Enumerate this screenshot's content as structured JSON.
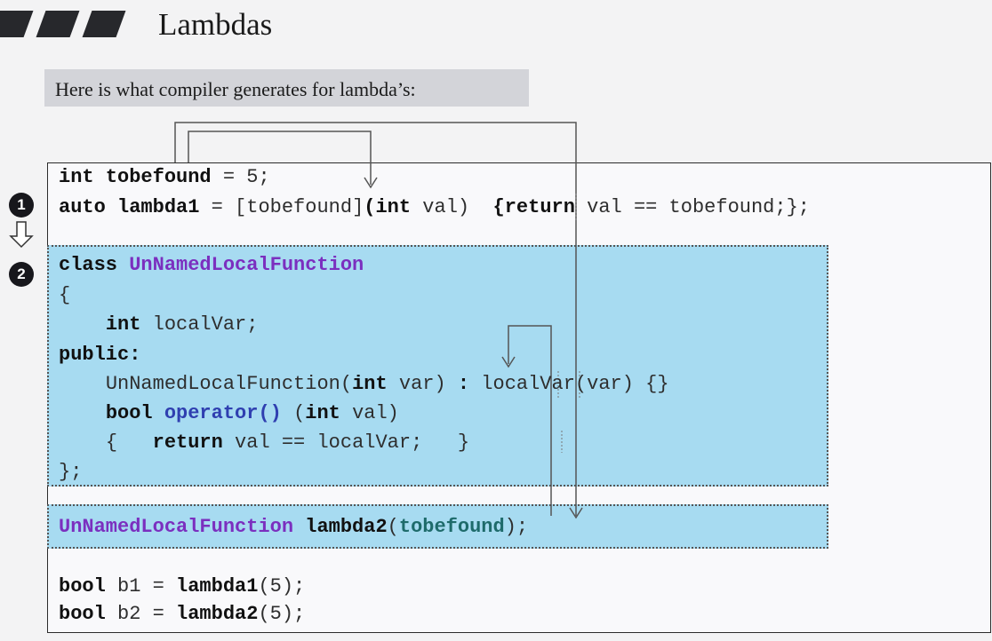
{
  "slide": {
    "title": "Lambdas",
    "subtitle": "Here is what compiler generates for lambda’s:",
    "badge1": "1",
    "badge2": "2"
  },
  "code": {
    "l1": {
      "kw": "int",
      "name": "tobefound",
      "rest": " = 5;"
    },
    "l2": {
      "kw": "auto",
      "name": "lambda1",
      "eq": " = ",
      "cap": "[tobefound]",
      "params_kw": "(int",
      "params_rest": " val)",
      "body_open": "{",
      "ret": "return",
      "body_rest": " val == tobefound;",
      "body_close": "};"
    },
    "l3": {
      "kw": "class",
      "name": "UnNamedLocalFunction"
    },
    "l4": "{",
    "l5": {
      "kw": "int",
      "rest": " localVar;"
    },
    "l6": "public:",
    "l7": {
      "ctor": "UnNamedLocalFunction(",
      "kw": "int",
      "rest": " var)",
      "colon": ":",
      "init": " localVar(var) {}"
    },
    "l8": {
      "kw": "bool",
      "op": "operator()",
      "p_open": "(",
      "p_kw": "int",
      "p_rest": " val)"
    },
    "l9": {
      "open": "{",
      "ret": "return",
      "rest": " val == localVar;",
      "close": "}"
    },
    "l10": "};",
    "l11": {
      "cls": "UnNamedLocalFunction",
      "name": "lambda2",
      "arg_open": "(",
      "arg": "tobefound",
      "arg_close": ");"
    },
    "l12": {
      "kw": "bool",
      "var": " b1 = ",
      "call": "lambda1",
      "rest": "(5);"
    },
    "l13": {
      "kw": "bool",
      "var": " b2 = ",
      "call": "lambda2",
      "rest": "(5);"
    }
  },
  "colors": {
    "highlight": "#a7dbf1",
    "class_name": "#7b2fbf",
    "operator": "#2f3fb0",
    "argument": "#1e6b6b"
  }
}
